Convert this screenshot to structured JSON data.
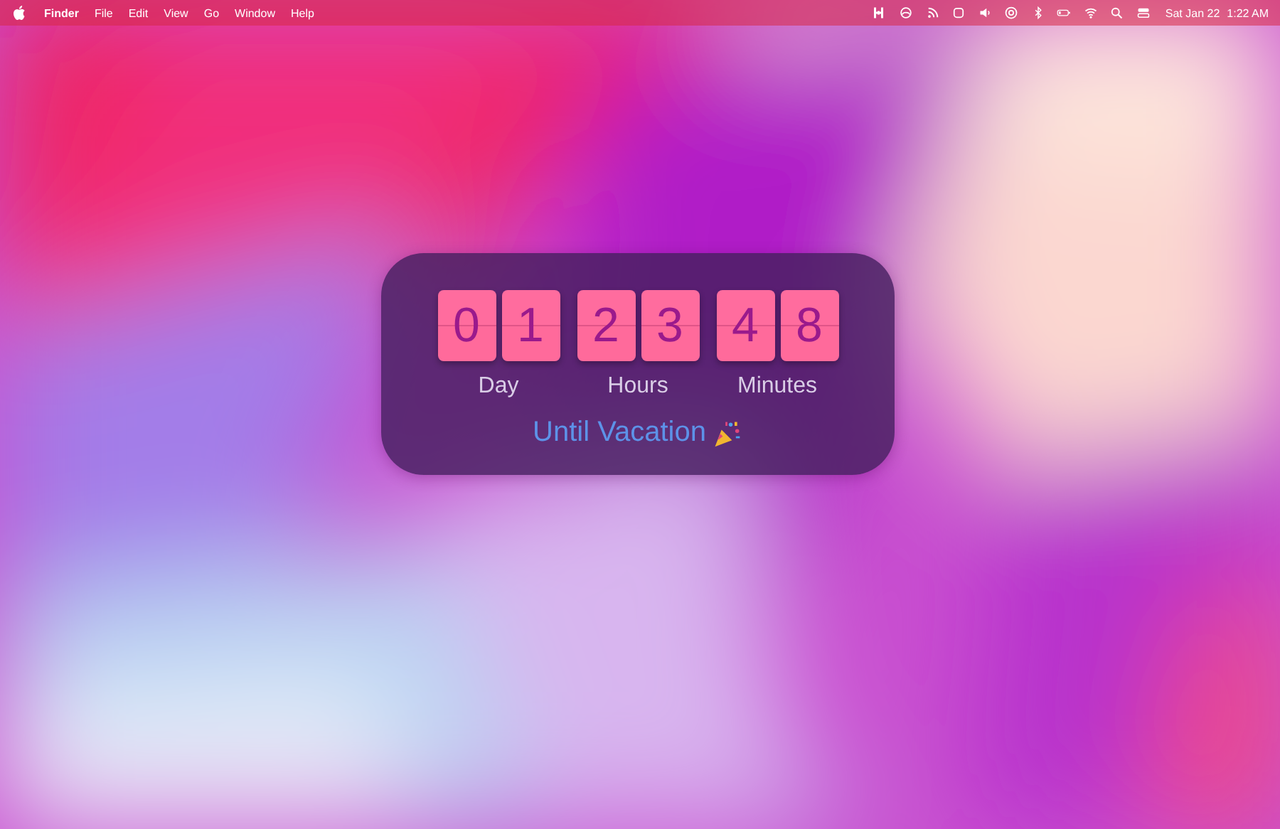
{
  "menu_bar": {
    "menus": [
      {
        "label": "Finder",
        "kind": "app"
      },
      {
        "label": "File",
        "kind": "menu"
      },
      {
        "label": "Edit",
        "kind": "menu"
      },
      {
        "label": "View",
        "kind": "menu"
      },
      {
        "label": "Go",
        "kind": "menu"
      },
      {
        "label": "Window",
        "kind": "menu"
      },
      {
        "label": "Help",
        "kind": "menu"
      }
    ],
    "date": "Sat Jan 22",
    "time": "1:22 AM"
  },
  "countdown": {
    "groups": [
      {
        "digits": [
          "0",
          "1"
        ],
        "label": "Day"
      },
      {
        "digits": [
          "2",
          "3"
        ],
        "label": "Hours"
      },
      {
        "digits": [
          "4",
          "8"
        ],
        "label": "Minutes"
      }
    ],
    "caption": "Until Vacation"
  }
}
